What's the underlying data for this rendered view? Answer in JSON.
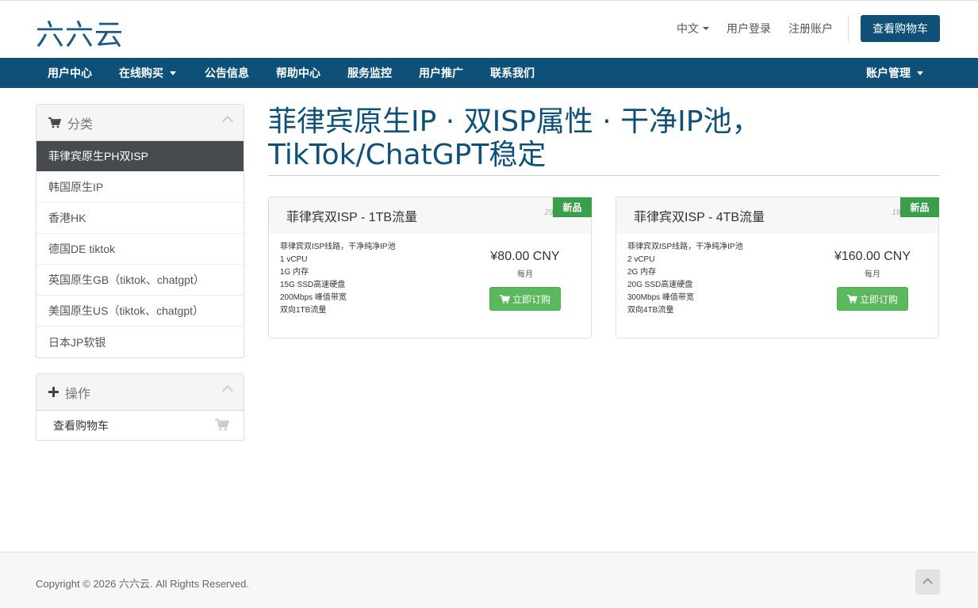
{
  "brand": {
    "logo": "六六云"
  },
  "top_links": {
    "language": "中文",
    "login": "用户登录",
    "register": "注册账户",
    "view_cart": "查看购物车"
  },
  "nav": {
    "items": [
      "用户中心",
      "在线购买",
      "公告信息",
      "帮助中心",
      "服务监控",
      "用户推广",
      "联系我们"
    ],
    "account": "账户管理"
  },
  "sidebar": {
    "categories_title": "分类",
    "categories": [
      "菲律宾原生PH双ISP",
      "韩国原生IP",
      "香港HK",
      "德国DE tiktok",
      "英国原生GB（tiktok、chatgpt）",
      "美国原生US（tiktok、chatgpt）",
      "日本JP软银"
    ],
    "active_index": 0,
    "actions_title": "操作",
    "actions": [
      "查看购物车"
    ]
  },
  "main": {
    "title_line1": "菲律宾原生IP · 双ISP属性 · 干净IP池，",
    "title_line2": "TikTok/ChatGPT稳定"
  },
  "products": [
    {
      "name": "菲律宾双ISP - 1TB流量",
      "stock": "290",
      "badge": "新品",
      "features": [
        "菲律宾双ISP线路，干净纯净IP池",
        "1 vCPU",
        "1G 内存",
        "15G SSD高速硬盘",
        "200Mbps 峰值带宽",
        "双向1TB流量"
      ],
      "price": "¥80.00 CNY",
      "cycle": "每月",
      "order_label": "立即订购"
    },
    {
      "name": "菲律宾双ISP - 4TB流量",
      "stock": "199",
      "badge": "新品",
      "features": [
        "菲律宾双ISP线路，干净纯净IP池",
        "2 vCPU",
        "2G 内存",
        "20G SSD高速硬盘",
        "300Mbps 峰值带宽",
        "双向4TB流量"
      ],
      "price": "¥160.00 CNY",
      "cycle": "每月",
      "order_label": "立即订购"
    }
  ],
  "footer": {
    "copyright": "Copyright © 2026 六六云. All Rights Reserved."
  },
  "colors": {
    "brand": "#0e5077",
    "active_category": "#474b50",
    "order_button": "#5cb85c",
    "badge": "#3a9e4c"
  }
}
